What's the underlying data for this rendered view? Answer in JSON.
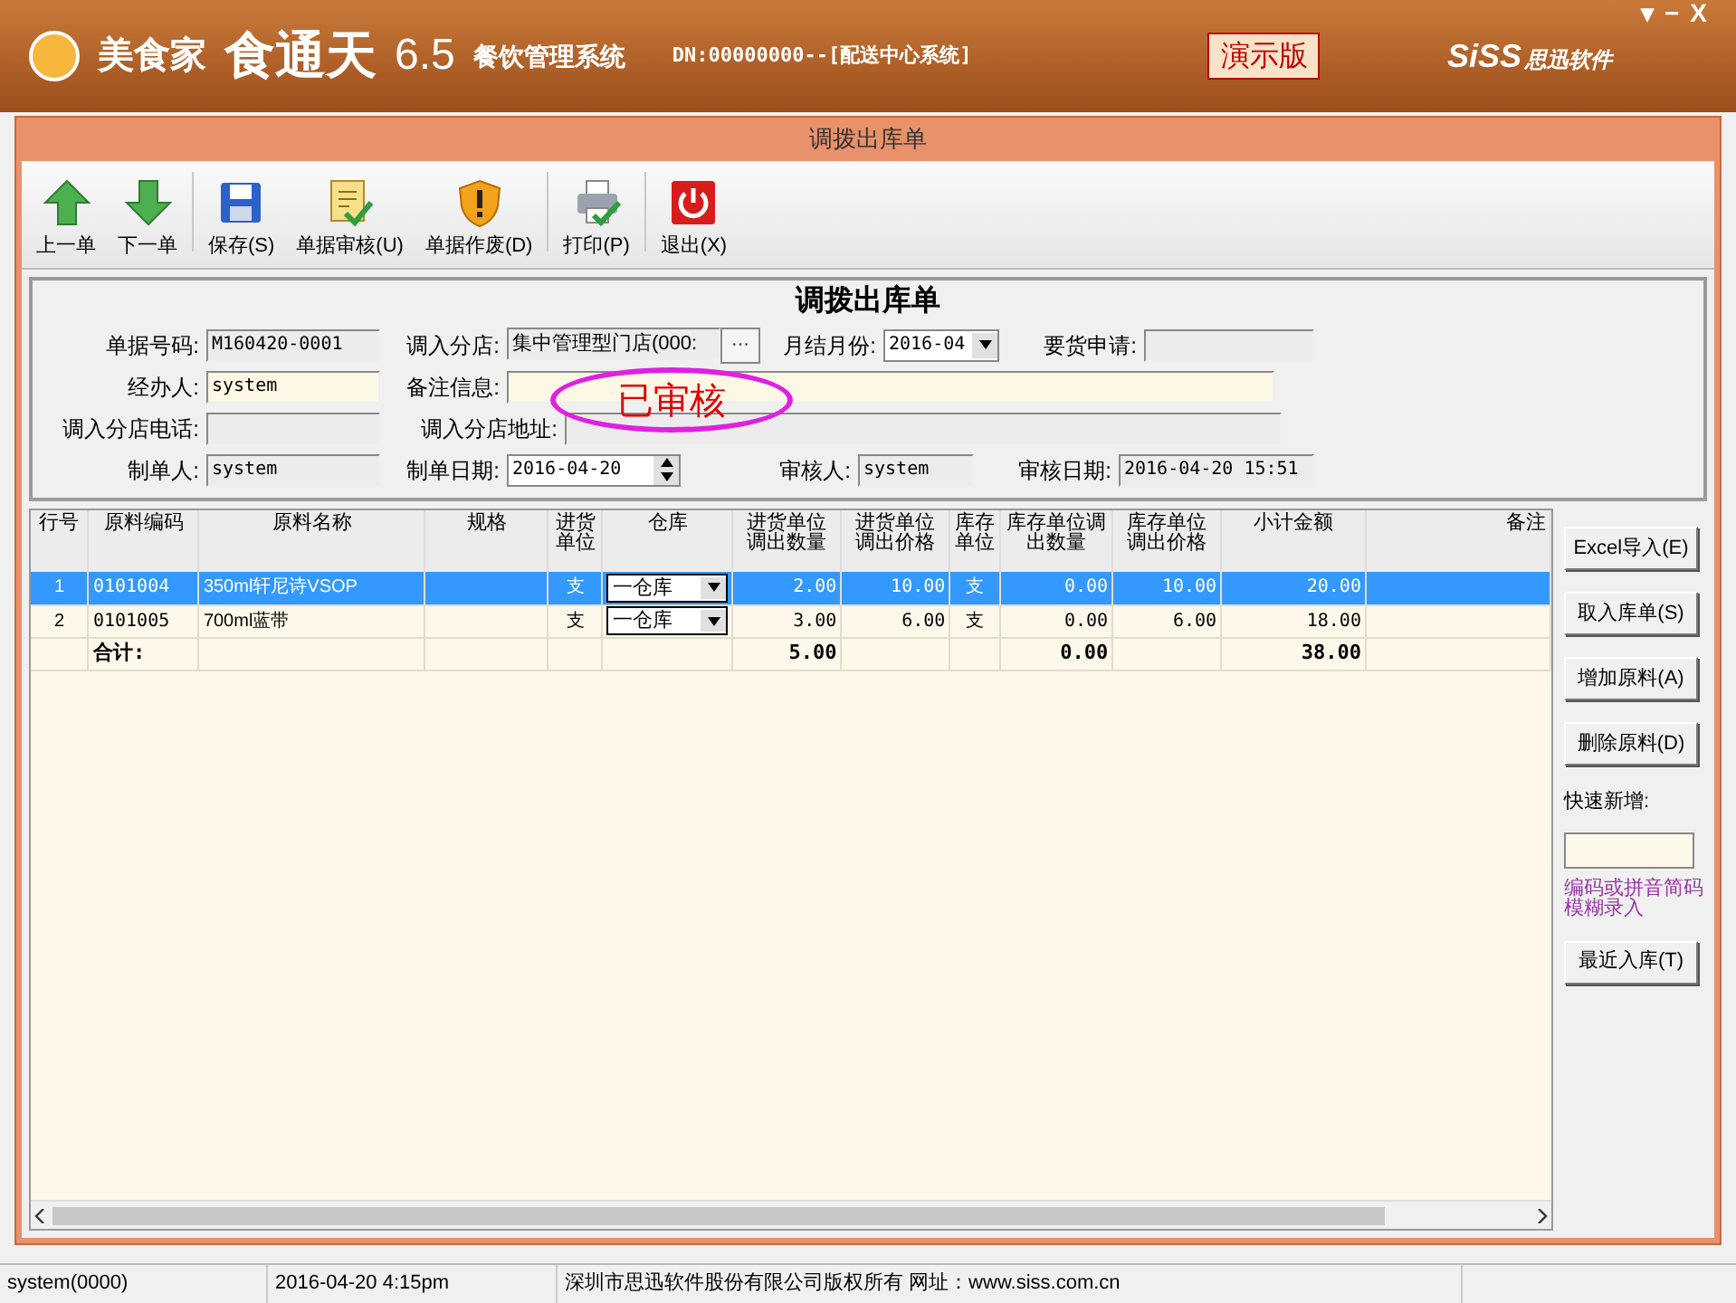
{
  "app_header": {
    "brand": "美食家",
    "product": "食通天",
    "version": "6.5",
    "subtitle": "餐饮管理系统",
    "db": "DN:00000000--[配送中心系统]",
    "edition": "演示版",
    "vendor_logo": "SiSS",
    "vendor": "思迅软件",
    "window_controls": [
      "▾",
      "−",
      "X"
    ]
  },
  "dialog": {
    "title": "调拨出库单",
    "toolbar": [
      {
        "label": "上一单"
      },
      {
        "label": "下一单"
      },
      {
        "label": "保存(S)"
      },
      {
        "label": "单据审核(U)"
      },
      {
        "label": "单据作废(D)"
      },
      {
        "label": "打印(P)"
      },
      {
        "label": "退出(X)"
      }
    ],
    "form": {
      "heading": "调拨出库单",
      "stamp": "已审核",
      "order_no": {
        "label": "单据号码:",
        "value": "M160420-0001"
      },
      "target_store": {
        "label": "调入分店:",
        "value": "集中管理型门店(000:",
        "button": "···"
      },
      "month": {
        "label": "月结月份:",
        "value": "2016-04"
      },
      "request": {
        "label": "要货申请:"
      },
      "handler": {
        "label": "经办人:",
        "value": "system"
      },
      "remark": {
        "label": "备注信息:"
      },
      "phone": {
        "label": "调入分店电话:"
      },
      "address": {
        "label": "调入分店地址:"
      },
      "creator": {
        "label": "制单人:",
        "value": "system"
      },
      "created": {
        "label": "制单日期:",
        "value": "2016-04-20"
      },
      "reviewer": {
        "label": "审核人:",
        "value": "system"
      },
      "reviewed": {
        "label": "审核日期:",
        "value": "2016-04-20 15:51"
      }
    },
    "table": {
      "columns": [
        "行号",
        "原料编码",
        "原料名称",
        "规格",
        "进货单位",
        "仓库",
        "进货单位调出数量",
        "进货单位调出价格",
        "库存单位",
        "库存单位调出数量",
        "库存单位调出价格",
        "小计金额",
        "备注"
      ],
      "rows": [
        {
          "kind": "item",
          "selected": true,
          "cells": [
            "1",
            "0101004",
            "350ml轩尼诗VSOP",
            "",
            "支",
            "一仓库",
            "2.00",
            "10.00",
            "支",
            "0.00",
            "10.00",
            "20.00",
            ""
          ]
        },
        {
          "kind": "item",
          "selected": false,
          "cells": [
            "2",
            "0101005",
            "700ml蓝带",
            "",
            "支",
            "一仓库",
            "3.00",
            "6.00",
            "支",
            "0.00",
            "6.00",
            "18.00",
            ""
          ]
        },
        {
          "kind": "total",
          "selected": false,
          "cells": [
            "",
            "合计:",
            "",
            "",
            "",
            "",
            "5.00",
            "",
            "",
            "0.00",
            "",
            "38.00",
            ""
          ]
        }
      ]
    },
    "side_panel": {
      "buttons": [
        "Excel导入(E)",
        "取入库单(S)",
        "增加原料(A)",
        "删除原料(D)"
      ],
      "quick_add_label": "快速新增:",
      "hint": "编码或拼音简码模糊录入",
      "recent_button": "最近入库(T)"
    }
  },
  "status_bar": [
    "system(0000)",
    "2016-04-20 4:15pm",
    "深圳市思迅软件股份有限公司版权所有 网址：www.siss.com.cn"
  ]
}
